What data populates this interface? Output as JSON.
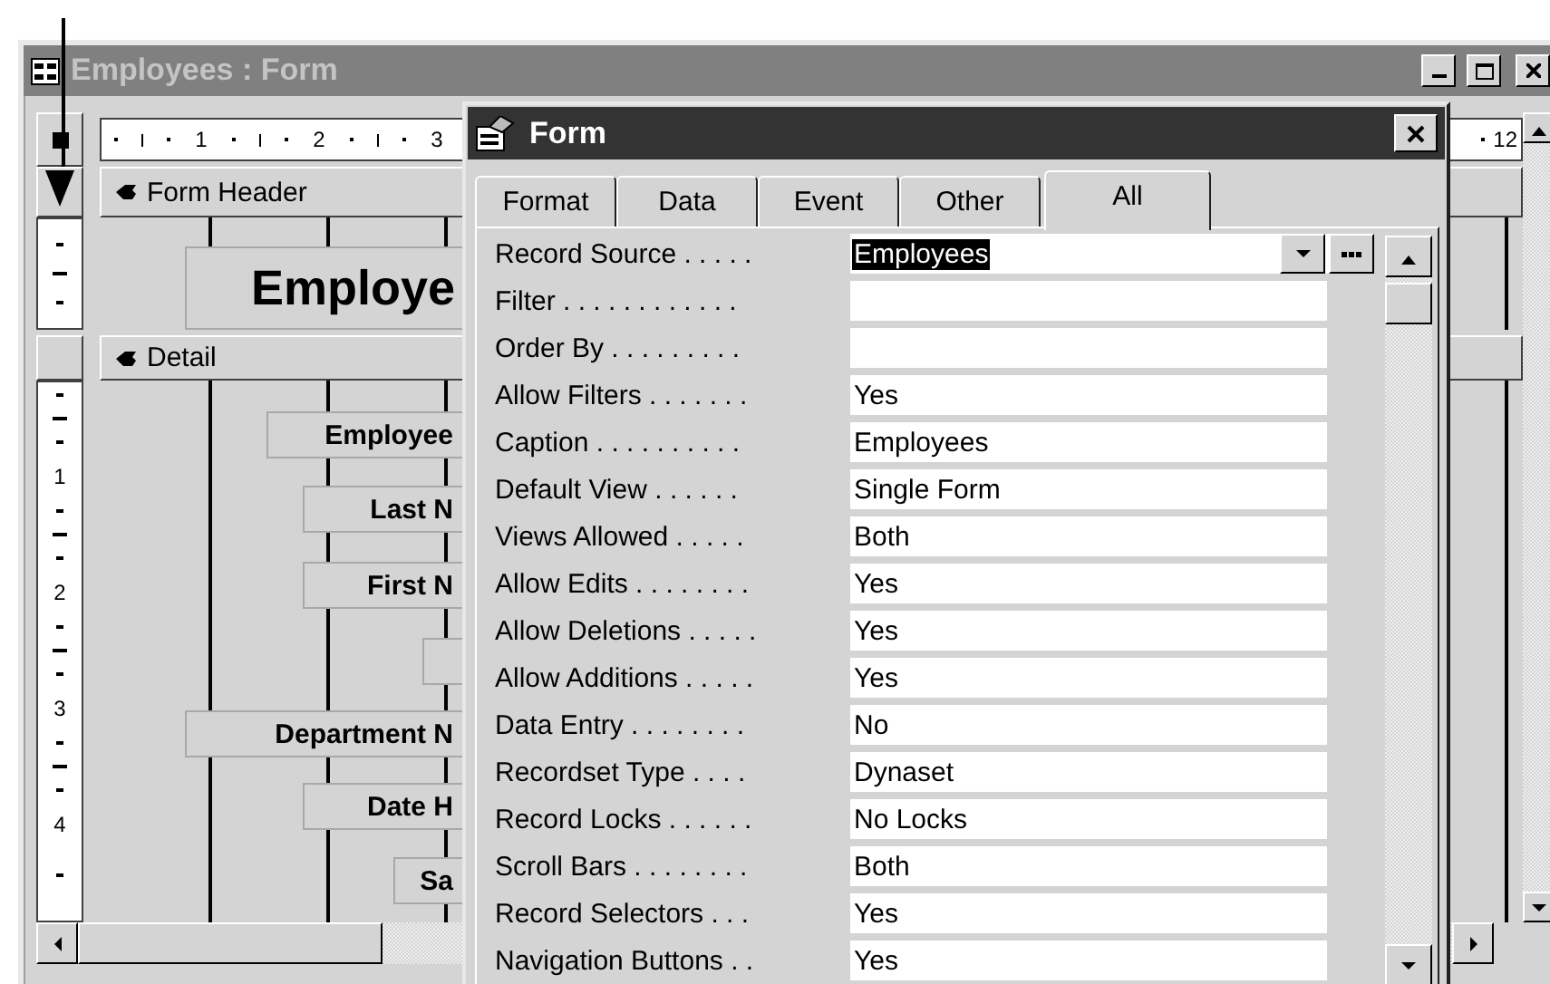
{
  "form_window": {
    "title": "Employees : Form",
    "ruler": {
      "left_marks": [
        "1",
        "2",
        "3"
      ],
      "right_marks": [
        "12"
      ]
    },
    "vertical_ruler": {
      "marks": [
        "1",
        "2",
        "3",
        "4"
      ]
    },
    "sections": [
      {
        "kind": "header",
        "title": "Form Header",
        "labels": [
          {
            "kind": "label",
            "text": "Employe"
          }
        ]
      },
      {
        "kind": "detail",
        "title": "Detail",
        "labels": [
          {
            "kind": "label",
            "text": "Employee"
          },
          {
            "kind": "label",
            "text": "Last N"
          },
          {
            "kind": "label",
            "text": "First N"
          },
          {
            "kind": "box"
          },
          {
            "kind": "label",
            "text": "Department N"
          },
          {
            "kind": "label",
            "text": "Date H"
          },
          {
            "kind": "label",
            "text": "Sa"
          }
        ]
      }
    ]
  },
  "property_sheet": {
    "title": "Form",
    "tabs": [
      {
        "label": "Format",
        "selected": false
      },
      {
        "label": "Data",
        "selected": false
      },
      {
        "label": "Event",
        "selected": false
      },
      {
        "label": "Other",
        "selected": false
      },
      {
        "label": "All",
        "selected": true
      }
    ],
    "properties": [
      {
        "label": "Record Source . . . . .",
        "value": "Employees",
        "selected": true
      },
      {
        "label": "Filter . . . . . . . . . . . .",
        "selected": false
      },
      {
        "label": "Order By . . . . . . . . .",
        "selected": false
      },
      {
        "label": "Allow Filters . . . . . . .",
        "value": "Yes",
        "selected": false
      },
      {
        "label": "Caption . . . . . . . . . .",
        "value": "Employees",
        "selected": false
      },
      {
        "label": "Default View . . . . . .",
        "value": "Single Form",
        "selected": false
      },
      {
        "label": "Views Allowed . . . . .",
        "value": "Both",
        "selected": false
      },
      {
        "label": "Allow Edits . . . . . . . .",
        "value": "Yes",
        "selected": false
      },
      {
        "label": "Allow Deletions . . . . .",
        "value": "Yes",
        "selected": false
      },
      {
        "label": "Allow Additions . . . . .",
        "value": "Yes",
        "selected": false
      },
      {
        "label": "Data Entry . . . . . . . .",
        "value": "No",
        "selected": false
      },
      {
        "label": "Recordset Type . . . .",
        "value": "Dynaset",
        "selected": false
      },
      {
        "label": "Record Locks . . . . . .",
        "value": "No Locks",
        "selected": false
      },
      {
        "label": "Scroll Bars . . . . . . . .",
        "value": "Both",
        "selected": false
      },
      {
        "label": "Record Selectors . . .",
        "value": "Yes",
        "selected": false
      },
      {
        "label": "Navigation Buttons . .",
        "value": "Yes",
        "selected": false
      }
    ]
  }
}
